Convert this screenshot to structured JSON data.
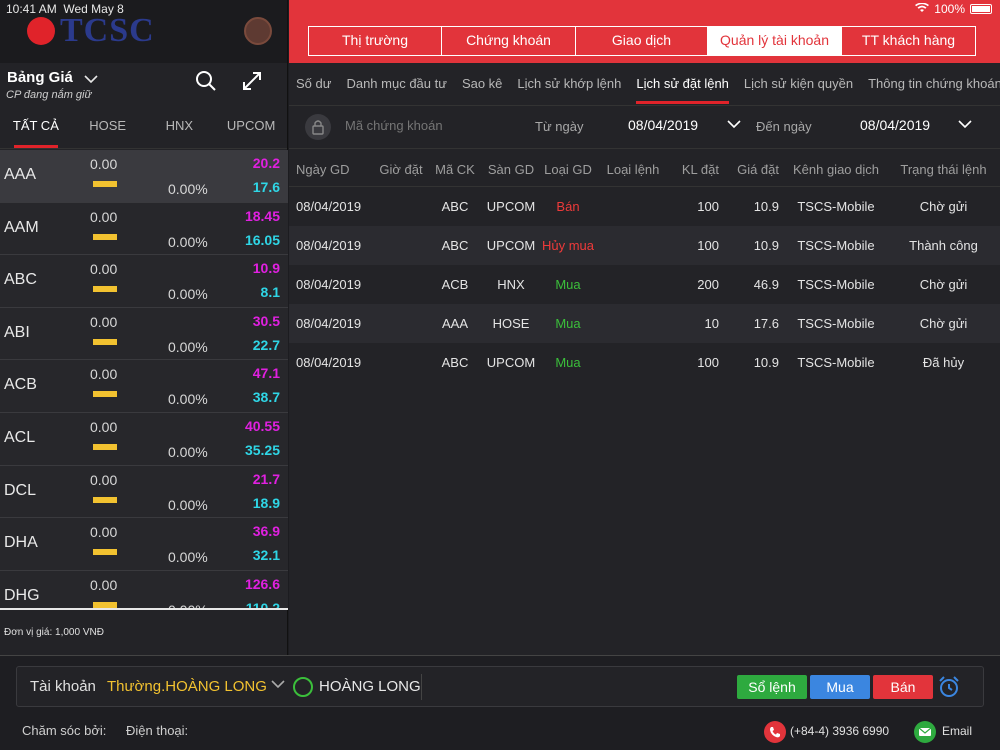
{
  "status": {
    "time": "10:41 AM",
    "date": "Wed May 8",
    "battery": "100%"
  },
  "brand": {
    "name": "TCSC"
  },
  "board": {
    "title": "Bảng Giá",
    "subtitle": "CP đang nắm giữ"
  },
  "market_tabs": [
    "TẤT CẢ",
    "HOSE",
    "HNX",
    "UPCOM"
  ],
  "stocks": [
    {
      "code": "AAA",
      "change": "0.00",
      "pct": "0.00%",
      "ceil": "20.2",
      "floor": "17.6"
    },
    {
      "code": "AAM",
      "change": "0.00",
      "pct": "0.00%",
      "ceil": "18.45",
      "floor": "16.05"
    },
    {
      "code": "ABC",
      "change": "0.00",
      "pct": "0.00%",
      "ceil": "10.9",
      "floor": "8.1"
    },
    {
      "code": "ABI",
      "change": "0.00",
      "pct": "0.00%",
      "ceil": "30.5",
      "floor": "22.7"
    },
    {
      "code": "ACB",
      "change": "0.00",
      "pct": "0.00%",
      "ceil": "47.1",
      "floor": "38.7"
    },
    {
      "code": "ACL",
      "change": "0.00",
      "pct": "0.00%",
      "ceil": "40.55",
      "floor": "35.25"
    },
    {
      "code": "DCL",
      "change": "0.00",
      "pct": "0.00%",
      "ceil": "21.7",
      "floor": "18.9"
    },
    {
      "code": "DHA",
      "change": "0.00",
      "pct": "0.00%",
      "ceil": "36.9",
      "floor": "32.1"
    },
    {
      "code": "DHG",
      "change": "0.00",
      "pct": "0.00%",
      "ceil": "126.6",
      "floor": "110.2"
    }
  ],
  "unit_note": "Đơn vị giá: 1,000 VNĐ",
  "main_tabs": [
    "Thị trường",
    "Chứng khoán",
    "Giao dịch",
    "Quản lý tài khoản",
    "TT khách hàng"
  ],
  "sub_tabs": [
    "Số dư",
    "Danh mục đầu tư",
    "Sao kê",
    "Lịch sử khớp lệnh",
    "Lịch sử đặt lệnh",
    "Lịch sử kiện quyền",
    "Thông tin chứng khoán"
  ],
  "filter": {
    "symbol_placeholder": "Mã chứng khoán",
    "from_label": "Từ ngày",
    "from_date": "08/04/2019",
    "to_label": "Đến ngày",
    "to_date": "08/04/2019"
  },
  "table": {
    "headers": [
      "Ngày GD",
      "Giờ đặt",
      "Mã CK",
      "Sàn GD",
      "Loại GD",
      "Loại lệnh",
      "KL đặt",
      "Giá đặt",
      "Kênh giao dịch",
      "Trạng thái lệnh"
    ],
    "rows": [
      {
        "date": "08/04/2019",
        "time": "",
        "symbol": "ABC",
        "exchange": "UPCOM",
        "type": "Bán",
        "order_type": "",
        "qty": "100",
        "price": "10.9",
        "channel": "TSCS-Mobile",
        "status": "Chờ gửi"
      },
      {
        "date": "08/04/2019",
        "time": "",
        "symbol": "ABC",
        "exchange": "UPCOM",
        "type": "Hủy mua",
        "order_type": "",
        "qty": "100",
        "price": "10.9",
        "channel": "TSCS-Mobile",
        "status": "Thành công"
      },
      {
        "date": "08/04/2019",
        "time": "",
        "symbol": "ACB",
        "exchange": "HNX",
        "type": "Mua",
        "order_type": "",
        "qty": "200",
        "price": "46.9",
        "channel": "TSCS-Mobile",
        "status": "Chờ gửi"
      },
      {
        "date": "08/04/2019",
        "time": "",
        "symbol": "AAA",
        "exchange": "HOSE",
        "type": "Mua",
        "order_type": "",
        "qty": "10",
        "price": "17.6",
        "channel": "TSCS-Mobile",
        "status": "Chờ gửi"
      },
      {
        "date": "08/04/2019",
        "time": "",
        "symbol": "ABC",
        "exchange": "UPCOM",
        "type": "Mua",
        "order_type": "",
        "qty": "100",
        "price": "10.9",
        "channel": "TSCS-Mobile",
        "status": "Đã hủy"
      }
    ]
  },
  "footer": {
    "account_label": "Tài khoản",
    "account_type": "Thường.HOÀNG LONG",
    "account_name": "HOÀNG LONG",
    "orders_button": "Sổ lệnh",
    "buy_button": "Mua",
    "sell_button": "Bán",
    "care_label": "Chăm sóc bởi:",
    "phone_label": "Điện thoại:",
    "hotline": "(+84-4) 3936 6990",
    "email_label": "Email"
  },
  "colors": {
    "accent": "#e2343b",
    "ceil": "#e020e0",
    "floor": "#2fd6e6",
    "buy": "#3bbf3b",
    "sell": "#ee3a3a"
  }
}
